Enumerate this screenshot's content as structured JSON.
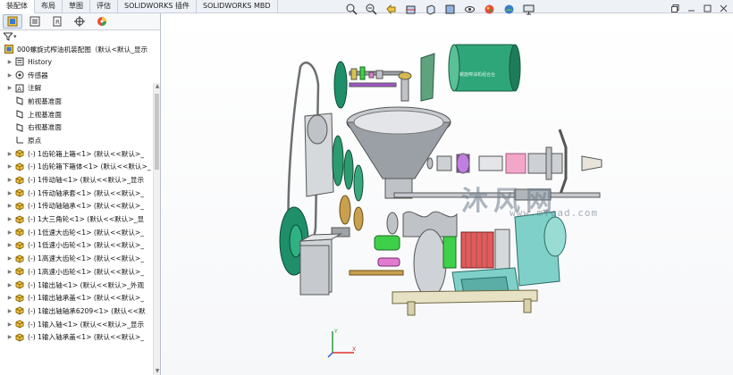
{
  "command_tabs": [
    {
      "label": "装配体",
      "active": true
    },
    {
      "label": "布局"
    },
    {
      "label": "草图"
    },
    {
      "label": "评估"
    },
    {
      "label": "SOLIDWORKS 插件"
    },
    {
      "label": "SOLIDWORKS MBD"
    }
  ],
  "panel_tabs": [
    "feature-manager-icon",
    "property-manager-icon",
    "configuration-manager-icon",
    "dimxpert-icon",
    "display-manager-icon"
  ],
  "filter": {
    "label": "▾"
  },
  "tree": {
    "root": "000螺旋式榨油机装配图（默认<默认_显示",
    "fixed_items": [
      {
        "label": "History",
        "icon": "history-icon",
        "expander": true
      },
      {
        "label": "传感器",
        "icon": "sensor-icon",
        "expander": true
      },
      {
        "label": "注解",
        "icon": "annotation-icon",
        "expander": true
      },
      {
        "label": "前视基准面",
        "icon": "plane-icon"
      },
      {
        "label": "上视基准面",
        "icon": "plane-icon"
      },
      {
        "label": "右视基准面",
        "icon": "plane-icon"
      },
      {
        "label": "原点",
        "icon": "origin-icon"
      }
    ],
    "components": [
      "(-) 1齿轮箱上箱<1> (默认<<默认>_",
      "(-) 1齿轮箱下箱体<1> (默认<<默认>_",
      "(-) 1传动轴<1> (默认<<默认>_显示",
      "(-) 1传动轴承套<1> (默认<<默认>_",
      "(-) 1传动轴轴承<1> (默认<<默认>_",
      "(-) 1大三角轮<1> (默认<<默认>_显",
      "(-) 1低速大齿轮<1> (默认<<默认>_",
      "(-) 1低速小齿轮<1> (默认<<默认>_",
      "(-) 1高速大齿轮<1> (默认<<默认>_",
      "(-) 1高速小齿轮<1> (默认<<默认>_",
      "(-) 1输出轴<1> (默认<<默认>_外观",
      "(-) 1输出轴承盖<1> (默认<<默认>_",
      "(-) 1输出轴轴承6209<1> (默认<<默",
      "(-) 1输入轴<1> (默认<<默认>_显示",
      "(-) 1输入轴承盖<1> (默认<<默认>_"
    ]
  },
  "view_toolbar": [
    "zoom-to-fit-icon",
    "zoom-area-icon",
    "previous-view-icon",
    "section-view-icon",
    "view-orientation-icon",
    "display-style-icon",
    "hide-show-icon",
    "appearance-icon",
    "scene-icon",
    "monitor-icon"
  ],
  "window_controls": [
    "restore-icon",
    "minimize-icon",
    "maximize-icon",
    "close-icon"
  ],
  "watermark": {
    "text": "沐风网",
    "sub": "www.mfcad.com"
  },
  "model_label": "螺旋榨油机组合台",
  "triad_axes": {
    "x": "X",
    "y": "Y",
    "z": "Z"
  },
  "colors": {
    "accent_green": "#1f8f6a",
    "metal_gray": "#bfc3c8",
    "hopper_gray": "#9aa0a6",
    "teal_block": "#7fd0c8",
    "tan_base": "#e8e2c4",
    "purple": "#a056c8",
    "pink": "#f2a7c9",
    "bright_green": "#3fd04a"
  }
}
